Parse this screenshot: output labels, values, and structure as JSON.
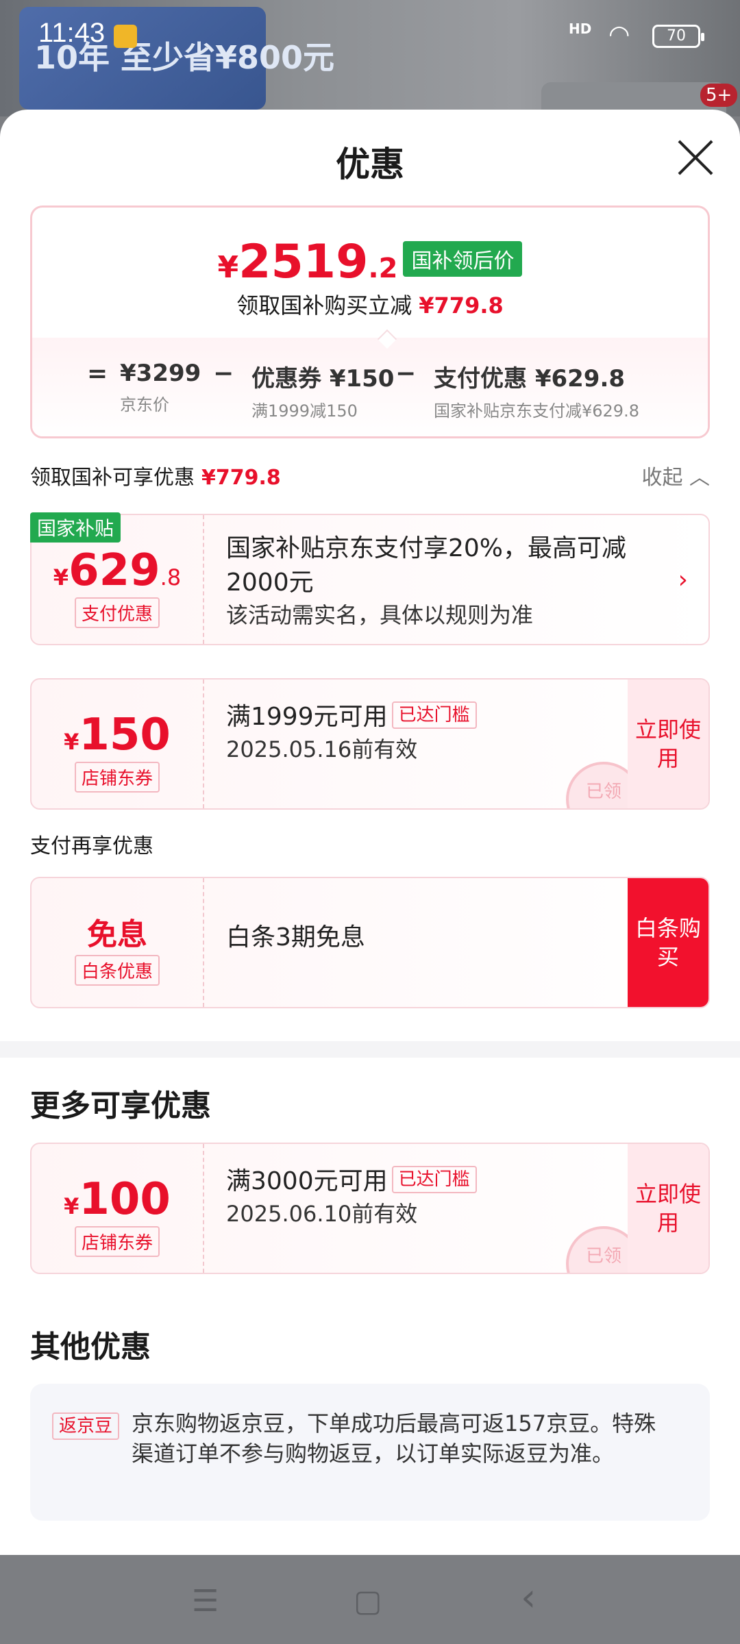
{
  "status": {
    "time": "11:43",
    "signal": "HD",
    "battery": "70",
    "ad_text": "10年 至少省¥800元",
    "ad_badge": "5+"
  },
  "header": {
    "title": "优惠"
  },
  "summary": {
    "price_yen": "¥",
    "price_int": "2519",
    "price_dec": ".2",
    "price_tag": "国补领后价",
    "reduce_label": "领取国补购买立减",
    "reduce_amount": "¥779.8",
    "eq": "=",
    "minus": "−",
    "items": [
      {
        "main": "¥3299",
        "note": "京东价"
      },
      {
        "main": "优惠券 ¥150",
        "note": "满1999减150"
      },
      {
        "main": "支付优惠 ¥629.8",
        "note": "国家补贴京东支付减¥629.8"
      }
    ]
  },
  "section1": {
    "label": "领取国补可享优惠",
    "amount": "¥779.8",
    "collapse": "收起"
  },
  "card1": {
    "flag": "国家补贴",
    "yen": "¥",
    "amount": "629",
    "dec": ".8",
    "label": "支付优惠",
    "title": "国家补贴京东支付享20%，最高可减2000元",
    "desc": "该活动需实名，具体以规则为准"
  },
  "card2": {
    "yen": "¥",
    "amount": "150",
    "label": "店铺东券",
    "title": "满1999元可用",
    "chip": "已达门槛",
    "desc": "2025.05.16前有效",
    "use": "立即使用",
    "stamp": "已领"
  },
  "section2": {
    "label": "支付再享优惠"
  },
  "card3": {
    "amount": "免息",
    "label": "白条优惠",
    "title": "白条3期免息",
    "use": "白条购买"
  },
  "section3": {
    "title": "更多可享优惠"
  },
  "card4": {
    "yen": "¥",
    "amount": "100",
    "label": "店铺东券",
    "title": "满3000元可用",
    "chip": "已达门槛",
    "desc": "2025.06.10前有效",
    "use": "立即使用",
    "stamp": "已领"
  },
  "section4": {
    "title": "其他优惠"
  },
  "other": {
    "badge": "返京豆",
    "text": "京东购物返京豆，下单成功后最高可返157京豆。特殊渠道订单不参与购物返豆，以订单实际返豆为准。"
  },
  "nav": {
    "menu": "☰",
    "home": "▢",
    "back": "‹"
  }
}
